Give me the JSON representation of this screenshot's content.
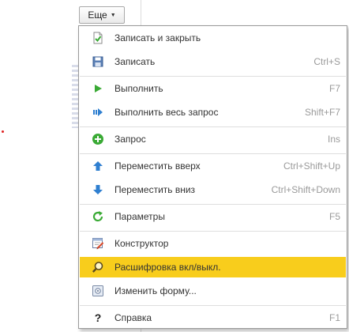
{
  "toolbar": {
    "more_label": "Еще"
  },
  "menu": {
    "items": [
      {
        "label": "Записать и закрыть",
        "shortcut": "",
        "icon": "save-and-close-icon"
      },
      {
        "label": "Записать",
        "shortcut": "Ctrl+S",
        "icon": "save-icon"
      },
      {
        "label": "Выполнить",
        "shortcut": "F7",
        "icon": "play-icon"
      },
      {
        "label": "Выполнить весь запрос",
        "shortcut": "Shift+F7",
        "icon": "run-all-icon"
      },
      {
        "label": "Запрос",
        "shortcut": "Ins",
        "icon": "add-query-icon"
      },
      {
        "label": "Переместить вверх",
        "shortcut": "Ctrl+Shift+Up",
        "icon": "arrow-up-icon"
      },
      {
        "label": "Переместить вниз",
        "shortcut": "Ctrl+Shift+Down",
        "icon": "arrow-down-icon"
      },
      {
        "label": "Параметры",
        "shortcut": "F5",
        "icon": "refresh-icon"
      },
      {
        "label": "Конструктор",
        "shortcut": "",
        "icon": "designer-icon"
      },
      {
        "label": "Расшифровка вкл/выкл.",
        "shortcut": "",
        "icon": "magnifier-icon"
      },
      {
        "label": "Изменить форму...",
        "shortcut": "",
        "icon": "form-icon"
      },
      {
        "label": "Справка",
        "shortcut": "F1",
        "icon": "help-icon"
      }
    ],
    "highlighted_label": "Расшифровка вкл/выкл."
  },
  "colors": {
    "highlight": "#f8cd1c",
    "shortcut_text": "#9a9a9a",
    "green": "#3aaa35",
    "blue": "#2f7fd0"
  }
}
